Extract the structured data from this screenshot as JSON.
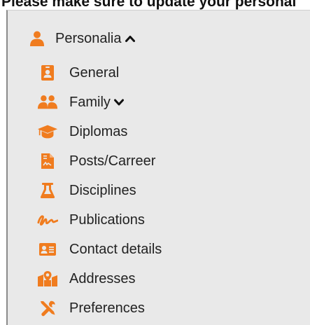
{
  "banner": {
    "text": "Please make sure to update your personal"
  },
  "colors": {
    "accent": "#f07c1f",
    "panel_bg": "#e9e9e9",
    "text": "#222222"
  },
  "menu": {
    "parent": {
      "label": "Personalia",
      "icon": "user-icon",
      "expanded": true
    },
    "items": [
      {
        "label": "General",
        "icon": "id-badge-icon",
        "has_submenu": false
      },
      {
        "label": "Family",
        "icon": "users-icon",
        "has_submenu": true,
        "expanded": false
      },
      {
        "label": "Diplomas",
        "icon": "graduation-cap-icon",
        "has_submenu": false
      },
      {
        "label": "Posts/Carreer",
        "icon": "file-signature-icon",
        "has_submenu": false
      },
      {
        "label": "Disciplines",
        "icon": "flask-icon",
        "has_submenu": false
      },
      {
        "label": "Publications",
        "icon": "signature-icon",
        "has_submenu": false
      },
      {
        "label": "Contact details",
        "icon": "address-card-icon",
        "has_submenu": false
      },
      {
        "label": "Addresses",
        "icon": "map-marked-icon",
        "has_submenu": false
      },
      {
        "label": "Preferences",
        "icon": "tools-icon",
        "has_submenu": false
      }
    ]
  }
}
